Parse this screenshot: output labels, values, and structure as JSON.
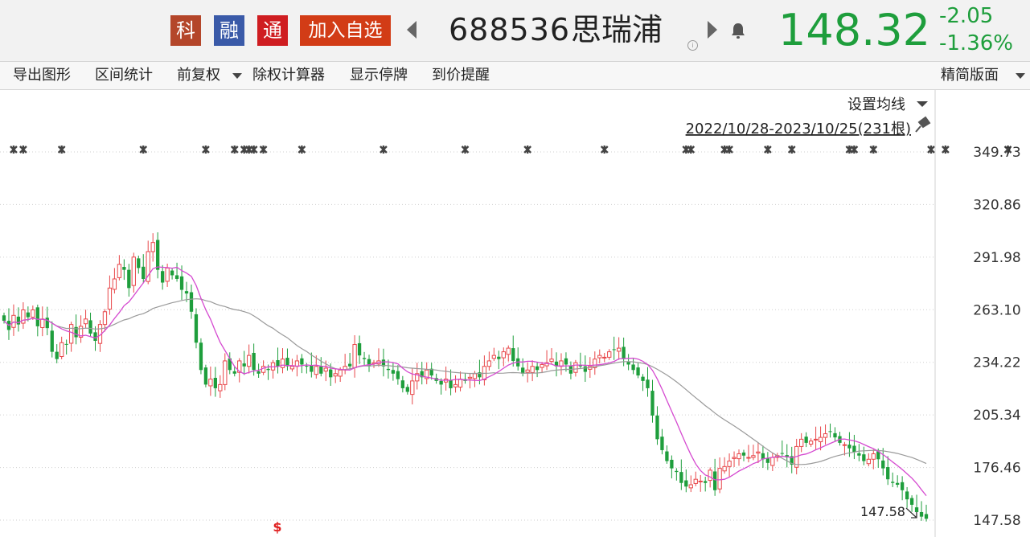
{
  "header": {
    "badges": {
      "ke": "科",
      "rong": "融",
      "tong": "通",
      "add": "加入自选"
    },
    "code": "688536",
    "name": "思瑞浦",
    "info": "i",
    "price": "148.32",
    "change": "-2.05",
    "change_pct": "-1.36%",
    "price_color": "#1e9e3c"
  },
  "toolbar": {
    "export": "导出图形",
    "interval": "区间统计",
    "adjust": "前复权",
    "calc": "除权计算器",
    "suspend": "显示停牌",
    "alert": "到价提醒",
    "simple": "精简版面"
  },
  "chart_data": {
    "type": "candlestick",
    "ma_setting_label": "设置均线",
    "range_label": "2022/10/28-2023/10/25(231根)",
    "y_ticks": [
      "349.73",
      "320.86",
      "291.98",
      "263.10",
      "234.22",
      "205.34",
      "176.46",
      "147.58"
    ],
    "ylim": [
      147.58,
      349.73
    ],
    "low_annotation": "147.58",
    "event_mark_symbol": "$",
    "up_color": "#e8474a",
    "down_color": "#1e9e3c",
    "ma_short_color": "#d54ad0",
    "ma_long_color": "#9a9a9a",
    "closes": [
      257,
      252,
      260,
      255,
      263,
      259,
      263,
      254,
      258,
      253,
      240,
      236,
      245,
      244,
      255,
      248,
      254,
      258,
      250,
      246,
      255,
      262,
      275,
      280,
      288,
      285,
      275,
      292,
      286,
      280,
      295,
      300,
      285,
      278,
      286,
      282,
      280,
      274,
      272,
      262,
      245,
      230,
      222,
      225,
      220,
      222,
      235,
      230,
      228,
      235,
      232,
      238,
      230,
      228,
      232,
      230,
      234,
      232,
      236,
      232,
      232,
      235,
      233,
      232,
      229,
      232,
      228,
      231,
      226,
      228,
      230,
      232,
      232,
      244,
      238,
      236,
      232,
      234,
      235,
      232,
      230,
      228,
      225,
      220,
      218,
      224,
      228,
      226,
      230,
      227,
      224,
      222,
      225,
      220,
      222,
      225,
      224,
      226,
      228,
      226,
      232,
      235,
      238,
      236,
      240,
      242,
      235,
      232,
      228,
      230,
      232,
      230,
      233,
      234,
      236,
      232,
      235,
      233,
      228,
      234,
      232,
      229,
      232,
      236,
      238,
      237,
      240,
      241,
      242,
      236,
      233,
      230,
      227,
      224,
      220,
      205,
      192,
      186,
      180,
      176,
      174,
      168,
      166,
      167,
      170,
      169,
      168,
      175,
      164,
      176,
      177,
      180,
      182,
      184,
      183,
      182,
      183,
      185,
      181,
      179,
      182,
      183,
      184,
      182,
      178,
      188,
      192,
      190,
      191,
      192,
      193,
      195,
      196,
      193,
      190,
      189,
      187,
      185,
      183,
      180,
      181,
      184,
      181,
      176,
      170,
      168,
      167,
      164,
      159,
      156,
      152,
      149.5,
      148.32
    ]
  }
}
